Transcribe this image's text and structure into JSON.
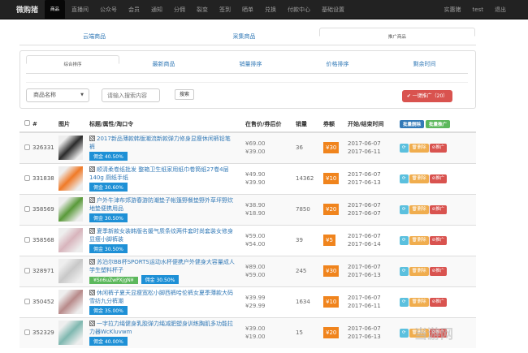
{
  "nav": {
    "brand": "微购猪",
    "items": [
      "商品",
      "直播间",
      "公众号",
      "会员",
      "通知",
      "分佣",
      "裂变",
      "签到",
      "晒单",
      "兑换",
      "付款中心",
      "基础设置"
    ],
    "active": 0,
    "right": [
      "实惠猪",
      "test",
      "退出"
    ]
  },
  "tabs": [
    "云端商品",
    "采集商品",
    "推广商品"
  ],
  "active_tab": 2,
  "sort_tabs": [
    "综合排序",
    "最新商品",
    "销量排序",
    "价格排序",
    "剩余时间"
  ],
  "search": {
    "select_value": "商品名称",
    "placeholder": "请输入搜索内容",
    "button": "搜索",
    "promote_all": "✔ 一键推广（20）"
  },
  "table": {
    "headers": [
      "#",
      "图片",
      "标题/属性/淘口令",
      "在售价/券后价",
      "销量",
      "券额",
      "开始/结束时间"
    ],
    "batch_delete": "批量删除",
    "batch_promote": "批量推广",
    "action_delete": "删除",
    "action_promote": "推广",
    "rows": [
      {
        "id": "326331",
        "title": "2017新品薄款韩版潮流新款弹力修身显瘦休闲裤铅笔裤",
        "tkl": "",
        "commission": "佣金 40.50%",
        "price": "¥69.00",
        "after": "¥39.00",
        "sales": "36",
        "coupon": "¥30",
        "start": "2017-06-07",
        "end": "2017-06-11",
        "img": "#2b2b2b"
      },
      {
        "id": "331838",
        "title": "顺清柔卷纸批发 整箱卫生纸家用纸巾卷筒纸27卷4层140g 厕纸手纸",
        "tkl": "",
        "commission": "佣金 30.60%",
        "price": "¥49.90",
        "after": "¥39.90",
        "sales": "14362",
        "coupon": "¥10",
        "start": "2017-06-07",
        "end": "2017-06-13",
        "img": "#f07a28"
      },
      {
        "id": "358569",
        "title": "户外牛津布郊游春游防潮垫子帐篷野餐垫野外草坪野炊地垫便携用品",
        "tkl": "",
        "commission": "佣金 30.50%",
        "price": "¥38.90",
        "after": "¥18.90",
        "sales": "7850",
        "coupon": "¥20",
        "start": "2017-06-07",
        "end": "2017-06-07",
        "img": "#5a9a3a"
      },
      {
        "id": "358568",
        "title": "夏季新款女装韩版名媛气质条纹两件套时尚套装女修身显瘦小脚裤装",
        "tkl": "",
        "commission": "佣金 30.50%",
        "price": "¥59.00",
        "after": "¥54.00",
        "sales": "39",
        "coupon": "¥5",
        "start": "2017-06-07",
        "end": "2017-06-14",
        "img": "#d8b4bc"
      },
      {
        "id": "328971",
        "title": "苏泊尔BB杯SPORTS运动水杯便携户外健身大容量成人学生塑料杯子",
        "tkl": "¥Sn6uZwPXjgN¥",
        "commission": "佣金 30.50%",
        "price": "¥89.00",
        "after": "¥59.00",
        "sales": "245",
        "coupon": "¥30",
        "start": "2017-06-07",
        "end": "2017-06-13",
        "img": "#c8c8c8"
      },
      {
        "id": "350452",
        "title": "休闲裤子夏天显瘦宽松小脚西裤哈伦裤女夏季薄款大码雪纺九分裤潮",
        "tkl": "",
        "commission": "佣金 35.00%",
        "price": "¥39.99",
        "after": "¥29.99",
        "sales": "1634",
        "coupon": "¥10",
        "start": "2017-06-07",
        "end": "2017-06-11",
        "img": "#b88a8a"
      },
      {
        "id": "352329",
        "title": "一字拉力绳健身乳胶弹力绳减肥塑身训练胸肌多功能拉力器WcKluvwm",
        "tkl": "",
        "commission": "佣金 40.00%",
        "price": "¥39.00",
        "after": "¥19.00",
        "sales": "15",
        "coupon": "¥20",
        "start": "2017-06-07",
        "end": "2017-06-13",
        "img": "#7fb8b0"
      }
    ]
  },
  "watermark": "当游网"
}
